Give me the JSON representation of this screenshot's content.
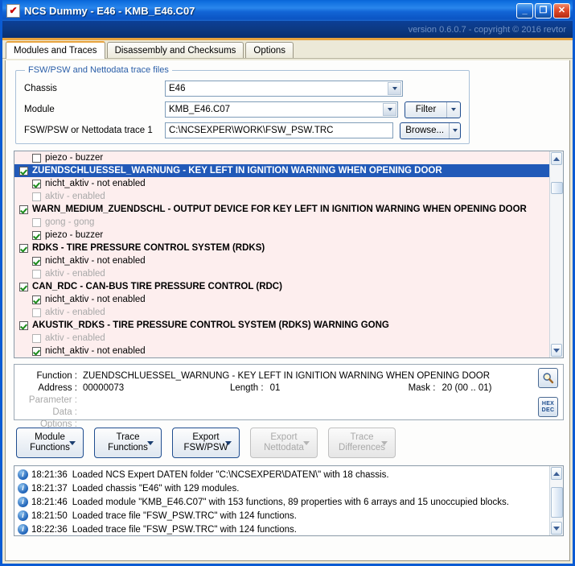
{
  "window": {
    "title": "NCS Dummy - E46 - KMB_E46.C07",
    "app_icon": "checkbox-icon",
    "minimize_label": "_",
    "maximize_label": "❐",
    "close_label": "✕",
    "version_text": "version 0.6.0.7 - copyright © 2016 revtor"
  },
  "tabs": [
    {
      "label": "Modules and Traces",
      "active": true
    },
    {
      "label": "Disassembly and Checksums",
      "active": false
    },
    {
      "label": "Options",
      "active": false
    }
  ],
  "groupbox": {
    "label": "FSW/PSW and Nettodata trace files",
    "rows": [
      {
        "label": "Chassis",
        "value": "E46",
        "control": "combo"
      },
      {
        "label": "Module",
        "value": "KMB_E46.C07",
        "control": "combo",
        "button": "Filter"
      },
      {
        "label": "FSW/PSW or Nettodata trace 1",
        "value": "C:\\NCSEXPER\\WORK\\FSW_PSW.TRC",
        "control": "text",
        "button": "Browse..."
      }
    ]
  },
  "list": {
    "rows": [
      {
        "text": "piezo  -  buzzer",
        "checked": false,
        "indent": true,
        "dim": false,
        "selected": false,
        "bold": false
      },
      {
        "text": "ZUENDSCHLUESSEL_WARNUNG  -  KEY LEFT IN IGNITION WARNING WHEN OPENING DOOR",
        "checked": true,
        "indent": false,
        "dim": false,
        "selected": true,
        "bold": true
      },
      {
        "text": "nicht_aktiv  -  not enabled",
        "checked": true,
        "indent": true,
        "dim": false,
        "selected": false,
        "bold": false
      },
      {
        "text": "aktiv  -  enabled",
        "checked": false,
        "indent": true,
        "dim": true,
        "selected": false,
        "bold": false
      },
      {
        "text": "WARN_MEDIUM_ZUENDSCHL  -  OUTPUT DEVICE FOR KEY LEFT IN IGNITION WARNING WHEN OPENING DOOR",
        "checked": true,
        "indent": false,
        "dim": false,
        "selected": false,
        "bold": true
      },
      {
        "text": "gong  -  gong",
        "checked": false,
        "indent": true,
        "dim": true,
        "selected": false,
        "bold": false
      },
      {
        "text": "piezo  -  buzzer",
        "checked": true,
        "indent": true,
        "dim": false,
        "selected": false,
        "bold": false
      },
      {
        "text": "RDKS  -  TIRE PRESSURE CONTROL SYSTEM (RDKS)",
        "checked": true,
        "indent": false,
        "dim": false,
        "selected": false,
        "bold": true
      },
      {
        "text": "nicht_aktiv  -  not enabled",
        "checked": true,
        "indent": true,
        "dim": false,
        "selected": false,
        "bold": false
      },
      {
        "text": "aktiv  -  enabled",
        "checked": false,
        "indent": true,
        "dim": true,
        "selected": false,
        "bold": false
      },
      {
        "text": "CAN_RDC  -  CAN-BUS TIRE PRESSURE CONTROL (RDC)",
        "checked": true,
        "indent": false,
        "dim": false,
        "selected": false,
        "bold": true
      },
      {
        "text": "nicht_aktiv  -  not enabled",
        "checked": true,
        "indent": true,
        "dim": false,
        "selected": false,
        "bold": false
      },
      {
        "text": "aktiv  -  enabled",
        "checked": false,
        "indent": true,
        "dim": true,
        "selected": false,
        "bold": false
      },
      {
        "text": "AKUSTIK_RDKS  -  TIRE PRESSURE CONTROL SYSTEM (RDKS) WARNING GONG",
        "checked": true,
        "indent": false,
        "dim": false,
        "selected": false,
        "bold": true
      },
      {
        "text": "aktiv  -  enabled",
        "checked": false,
        "indent": true,
        "dim": true,
        "selected": false,
        "bold": false
      },
      {
        "text": "nicht_aktiv  -  not enabled",
        "checked": true,
        "indent": true,
        "dim": false,
        "selected": false,
        "bold": false
      }
    ]
  },
  "detail": {
    "function_label": "Function :",
    "function_value": "ZUENDSCHLUESSEL_WARNUNG  -  KEY LEFT IN IGNITION WARNING WHEN OPENING DOOR",
    "address_label": "Address :",
    "address_value": "00000073",
    "length_label": "Length :",
    "length_value": "01",
    "mask_label": "Mask :",
    "mask_value": "20 (00 .. 01)",
    "parameter_label": "Parameter :",
    "parameter_value": "",
    "data_label": "Data :",
    "data_value": "",
    "options_label": "Options :",
    "options_value": "",
    "search_icon": "magnifier-icon",
    "hex_label": "HEX",
    "dec_label": "DEC"
  },
  "actions": [
    {
      "line1": "Module",
      "line2": "Functions",
      "disabled": false
    },
    {
      "line1": "Trace",
      "line2": "Functions",
      "disabled": false
    },
    {
      "line1": "Export",
      "line2": "FSW/PSW",
      "disabled": false
    },
    {
      "line1": "Export",
      "line2": "Nettodata",
      "disabled": true
    },
    {
      "line1": "Trace",
      "line2": "Differences",
      "disabled": true
    }
  ],
  "log": {
    "icon": "info-icon",
    "entries": [
      {
        "time": "18:21:36",
        "message": "Loaded NCS Expert DATEN folder \"C:\\NCSEXPER\\DATEN\\\" with 18 chassis."
      },
      {
        "time": "18:21:37",
        "message": "Loaded chassis \"E46\" with 129 modules."
      },
      {
        "time": "18:21:46",
        "message": "Loaded module \"KMB_E46.C07\" with 153 functions, 89 properties with 6 arrays and 15 unoccupied blocks."
      },
      {
        "time": "18:21:50",
        "message": "Loaded trace file \"FSW_PSW.TRC\" with 124 functions."
      },
      {
        "time": "18:22:36",
        "message": "Loaded trace file \"FSW_PSW.TRC\" with 124 functions."
      }
    ]
  },
  "colors": {
    "titlebar": "#1265d6",
    "accent_orange": "#e8a33d",
    "list_background": "#fdeeee",
    "selection": "#2159b8",
    "button_border": "#1f4d8f"
  }
}
